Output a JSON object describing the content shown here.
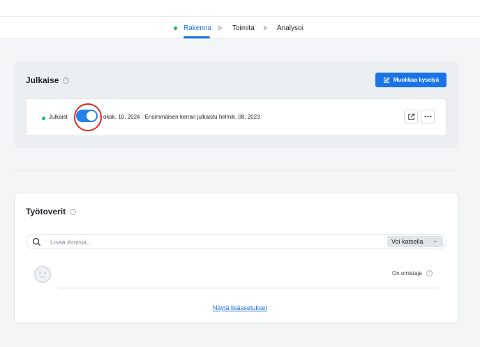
{
  "nav": {
    "steps": [
      {
        "label": "Rakenna",
        "active": true
      },
      {
        "label": "Toimita",
        "active": false
      },
      {
        "label": "Analysoi",
        "active": false
      }
    ]
  },
  "publish": {
    "title": "Julkaise",
    "edit_button": "Muokkaa kyselyä",
    "status_label": "Julkaist",
    "status_detail": "okak. 10, 2024 · Ensimmäisen kerran julkaistu helmik. 08, 2023",
    "toggle_on": true
  },
  "team": {
    "title": "Työtoverit",
    "search_placeholder": "Lisää ihmisiä...",
    "permission": "Voi katsella",
    "owner_label": "On omistaja",
    "more_settings": "Näytä lisäasetukset"
  },
  "colors": {
    "accent": "#1a73e8",
    "status_green": "#1bb56a",
    "focus_ring": "#e0271f"
  },
  "icons": [
    "help-icon",
    "edit-icon",
    "external-link-icon",
    "more-icon",
    "search-icon",
    "chevron-down-icon",
    "avatar-icon"
  ]
}
